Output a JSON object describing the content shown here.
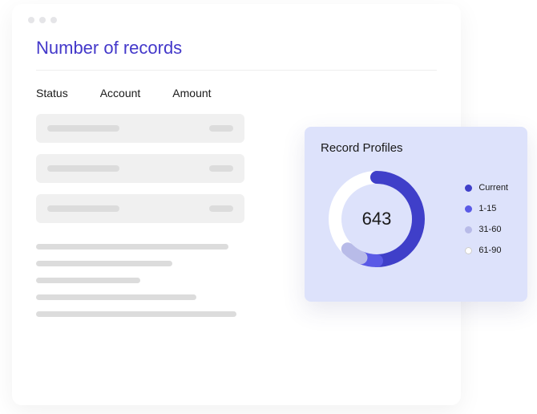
{
  "main": {
    "title": "Number of records",
    "columns": [
      "Status",
      "Account",
      "Amount"
    ]
  },
  "profile_card": {
    "title": "Record Profiles",
    "center_value": "643",
    "legend": [
      {
        "label": "Current",
        "color": "#3f3fc9"
      },
      {
        "label": "1-15",
        "color": "#5a5ae6"
      },
      {
        "label": "31-60",
        "color": "#b8bbe8"
      },
      {
        "label": "61-90",
        "color": "#ffffff"
      }
    ]
  },
  "chart_data": {
    "type": "pie",
    "title": "Record Profiles",
    "center_value": 643,
    "series": [
      {
        "name": "Current",
        "value": 50,
        "color": "#3f3fc9"
      },
      {
        "name": "1-15",
        "value": 6,
        "color": "#5a5ae6"
      },
      {
        "name": "31-60",
        "value": 6,
        "color": "#b8bbe8"
      },
      {
        "name": "61-90",
        "value": 38,
        "color": "#ffffff"
      }
    ]
  }
}
